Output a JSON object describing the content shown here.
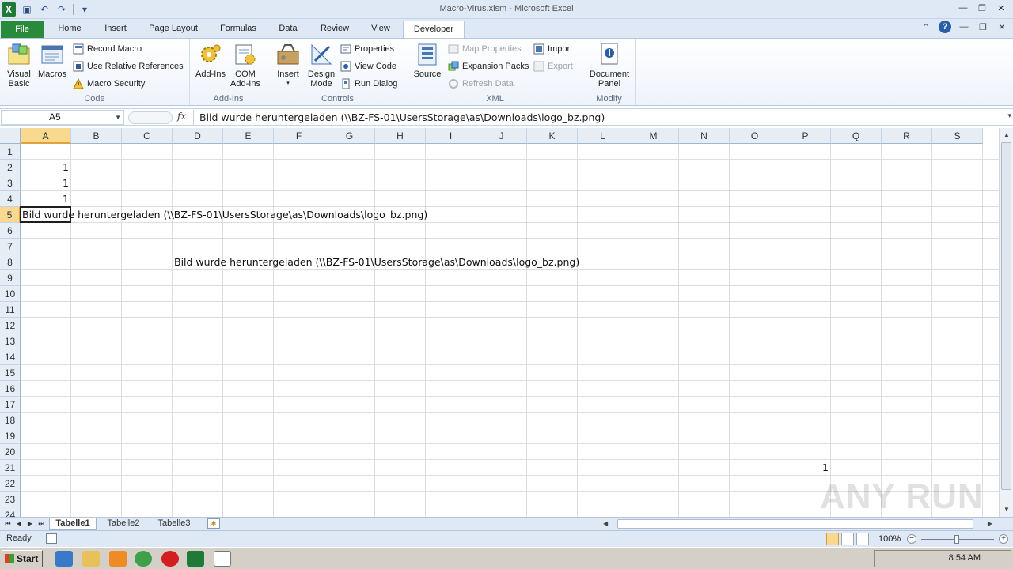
{
  "window": {
    "title": "Macro-Virus.xlsm  -  Microsoft Excel",
    "app_icon_letter": "X"
  },
  "ribbon_tabs": [
    {
      "label": "File"
    },
    {
      "label": "Home"
    },
    {
      "label": "Insert"
    },
    {
      "label": "Page Layout"
    },
    {
      "label": "Formulas"
    },
    {
      "label": "Data"
    },
    {
      "label": "Review"
    },
    {
      "label": "View"
    },
    {
      "label": "Developer"
    }
  ],
  "active_tab": "Developer",
  "ribbon": {
    "code": {
      "label": "Code",
      "visual_basic": "Visual Basic",
      "macros": "Macros",
      "record_macro": "Record Macro",
      "relative_refs": "Use Relative References",
      "macro_security": "Macro Security"
    },
    "addins": {
      "label": "Add-Ins",
      "addins_btn": "Add-Ins",
      "com_addins": "COM Add-Ins"
    },
    "controls": {
      "label": "Controls",
      "insert": "Insert",
      "design_mode": "Design Mode",
      "properties": "Properties",
      "view_code": "View Code",
      "run_dialog": "Run Dialog"
    },
    "xml": {
      "label": "XML",
      "source": "Source",
      "map_properties": "Map Properties",
      "expansion_packs": "Expansion Packs",
      "refresh_data": "Refresh Data",
      "import": "Import",
      "export": "Export"
    },
    "modify": {
      "label": "Modify",
      "document_panel": "Document Panel"
    }
  },
  "formula_bar": {
    "name_box": "A5",
    "fx": "fx",
    "content": "Bild wurde heruntergeladen (\\\\BZ-FS-01\\UsersStorage\\as\\Downloads\\logo_bz.png)"
  },
  "grid": {
    "columns": [
      "A",
      "B",
      "C",
      "D",
      "E",
      "F",
      "G",
      "H",
      "I",
      "J",
      "K",
      "L",
      "M",
      "N",
      "O",
      "P",
      "Q",
      "R",
      "S"
    ],
    "rows": [
      "1",
      "2",
      "3",
      "4",
      "5",
      "6",
      "7",
      "8",
      "9",
      "10",
      "11",
      "12",
      "13",
      "14",
      "15",
      "16",
      "17",
      "18",
      "19",
      "20",
      "21",
      "22",
      "23",
      "24"
    ],
    "cells": {
      "A2": "1",
      "A3": "1",
      "A4": "1",
      "A5": "Bild wurde heruntergeladen (\\\\BZ-FS-01\\UsersStorage\\as\\Downloads\\logo_bz.png)",
      "D8": "Bild wurde heruntergeladen (\\\\BZ-FS-01\\UsersStorage\\as\\Downloads\\logo_bz.png)",
      "P21": "1"
    },
    "selected_cell": "A5"
  },
  "sheets": [
    {
      "label": "Tabelle1"
    },
    {
      "label": "Tabelle2"
    },
    {
      "label": "Tabelle3"
    }
  ],
  "active_sheet": "Tabelle1",
  "status": {
    "ready": "Ready",
    "zoom": "100%"
  },
  "taskbar": {
    "start": "Start",
    "clock": "8:54 AM"
  },
  "watermark": "ANY RUN"
}
